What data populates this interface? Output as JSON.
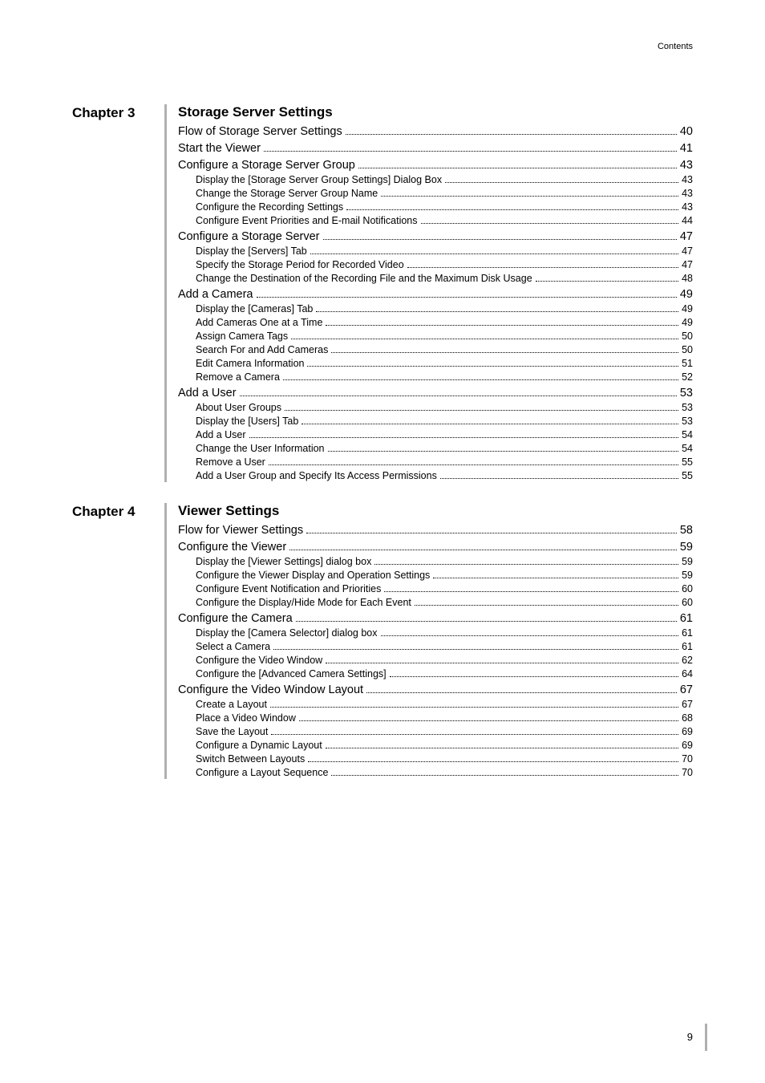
{
  "header": "Contents",
  "page_number": "9",
  "chapters": [
    {
      "label": "Chapter 3",
      "title": "Storage Server Settings",
      "entries": [
        {
          "level": 1,
          "text": "Flow of Storage Server Settings",
          "page": "40"
        },
        {
          "level": 1,
          "text": "Start the Viewer",
          "page": "41"
        },
        {
          "level": 1,
          "text": "Configure a Storage Server Group",
          "page": "43"
        },
        {
          "level": 2,
          "text": "Display the [Storage Server Group Settings] Dialog Box",
          "page": "43"
        },
        {
          "level": 2,
          "text": "Change the Storage Server Group Name",
          "page": "43"
        },
        {
          "level": 2,
          "text": "Configure the Recording Settings",
          "page": "43"
        },
        {
          "level": 2,
          "text": "Configure Event Priorities and E-mail Notifications",
          "page": "44"
        },
        {
          "level": 1,
          "text": "Configure a Storage Server",
          "page": "47"
        },
        {
          "level": 2,
          "text": "Display the [Servers] Tab",
          "page": "47"
        },
        {
          "level": 2,
          "text": "Specify the Storage Period for Recorded Video",
          "page": "47"
        },
        {
          "level": 2,
          "text": "Change the Destination of the Recording File and the Maximum Disk Usage",
          "page": "48"
        },
        {
          "level": 1,
          "text": "Add a Camera",
          "page": "49"
        },
        {
          "level": 2,
          "text": "Display the [Cameras] Tab",
          "page": "49"
        },
        {
          "level": 2,
          "text": "Add Cameras One at a Time",
          "page": "49"
        },
        {
          "level": 2,
          "text": "Assign Camera Tags",
          "page": "50"
        },
        {
          "level": 2,
          "text": "Search For and Add Cameras",
          "page": "50"
        },
        {
          "level": 2,
          "text": "Edit Camera Information",
          "page": "51"
        },
        {
          "level": 2,
          "text": "Remove a Camera",
          "page": "52"
        },
        {
          "level": 1,
          "text": "Add a User",
          "page": "53"
        },
        {
          "level": 2,
          "text": "About User Groups",
          "page": "53"
        },
        {
          "level": 2,
          "text": "Display the [Users] Tab",
          "page": "53"
        },
        {
          "level": 2,
          "text": "Add a User",
          "page": "54"
        },
        {
          "level": 2,
          "text": "Change the User Information",
          "page": "54"
        },
        {
          "level": 2,
          "text": "Remove a User",
          "page": "55"
        },
        {
          "level": 2,
          "text": "Add a User Group and Specify Its Access Permissions",
          "page": "55"
        }
      ]
    },
    {
      "label": "Chapter 4",
      "title": "Viewer Settings",
      "entries": [
        {
          "level": 1,
          "text": "Flow for Viewer Settings",
          "page": "58"
        },
        {
          "level": 1,
          "text": "Configure the Viewer",
          "page": "59"
        },
        {
          "level": 2,
          "text": "Display the [Viewer Settings] dialog box",
          "page": "59"
        },
        {
          "level": 2,
          "text": "Configure the Viewer Display and Operation Settings",
          "page": "59"
        },
        {
          "level": 2,
          "text": "Configure Event Notification and Priorities",
          "page": "60"
        },
        {
          "level": 2,
          "text": "Configure the Display/Hide Mode for Each Event",
          "page": "60"
        },
        {
          "level": 1,
          "text": "Configure the Camera",
          "page": "61"
        },
        {
          "level": 2,
          "text": "Display the [Camera Selector] dialog box",
          "page": "61"
        },
        {
          "level": 2,
          "text": "Select a Camera",
          "page": "61"
        },
        {
          "level": 2,
          "text": "Configure the Video Window",
          "page": "62"
        },
        {
          "level": 2,
          "text": "Configure the [Advanced Camera Settings]",
          "page": "64"
        },
        {
          "level": 1,
          "text": "Configure the Video Window Layout",
          "page": "67"
        },
        {
          "level": 2,
          "text": "Create a Layout",
          "page": "67"
        },
        {
          "level": 2,
          "text": "Place a Video Window",
          "page": "68"
        },
        {
          "level": 2,
          "text": "Save the Layout",
          "page": "69"
        },
        {
          "level": 2,
          "text": "Configure a Dynamic Layout",
          "page": "69"
        },
        {
          "level": 2,
          "text": "Switch Between Layouts",
          "page": "70"
        },
        {
          "level": 2,
          "text": "Configure a Layout Sequence",
          "page": "70"
        }
      ]
    }
  ]
}
